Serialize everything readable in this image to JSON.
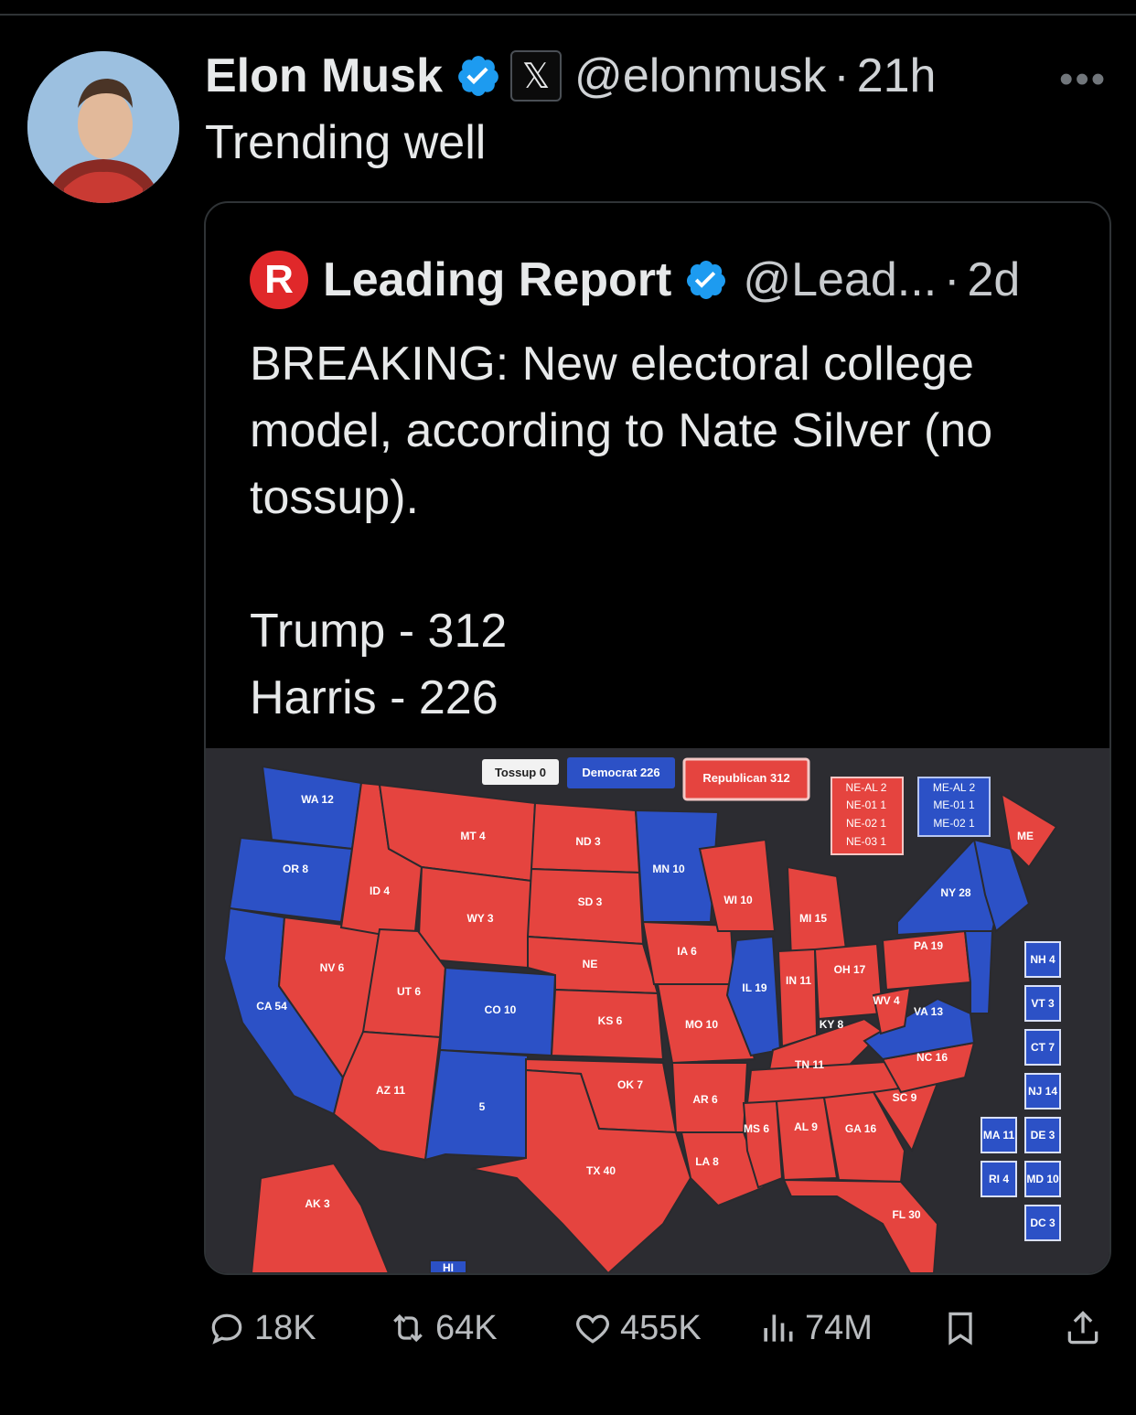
{
  "tweet": {
    "author_name": "Elon Musk",
    "handle": "@elonmusk",
    "separator": "·",
    "time": "21h",
    "text": "Trending well",
    "more_icon": "more-icon",
    "x_badge": "𝕏"
  },
  "quote": {
    "author_name": "Leading Report",
    "logo_letter": "R",
    "handle": "@Lead...",
    "separator": "·",
    "time": "2d",
    "text_lines": [
      "BREAKING: New electoral college model, according to Nate Silver (no tossup).",
      "Trump - 312",
      "Harris - 226"
    ]
  },
  "map": {
    "legend": {
      "tossup": "Tossup 0",
      "democrat": "Democrat 226",
      "republican": "Republican 312"
    },
    "ne_box": [
      "NE-AL 2",
      "NE-01 1",
      "NE-02 1",
      "NE-03 1"
    ],
    "me_box": [
      "ME-AL 2",
      "ME-01 1",
      "ME-02 1"
    ],
    "colors": {
      "democrat": "#2c51c6",
      "republican": "#e5443f",
      "background": "#2c2c31"
    },
    "states": {
      "WA": "WA 12",
      "OR": "OR 8",
      "CA": "CA 54",
      "NV": "NV 6",
      "ID": "ID 4",
      "MT": "MT 4",
      "WY": "WY 3",
      "UT": "UT 6",
      "CO": "CO 10",
      "AZ": "AZ 11",
      "NM": "5",
      "ND": "ND 3",
      "SD": "SD 3",
      "NE": "NE",
      "KS": "KS 6",
      "OK": "OK 7",
      "TX": "TX 40",
      "MN": "MN 10",
      "IA": "IA 6",
      "MO": "MO 10",
      "AR": "AR 6",
      "LA": "LA 8",
      "WI": "WI 10",
      "IL": "IL 19",
      "MI": "MI 15",
      "IN": "IN 11",
      "OH": "OH 17",
      "KY": "KY 8",
      "TN": "TN 11",
      "MS": "MS 6",
      "AL": "AL 9",
      "GA": "GA 16",
      "FL": "FL 30",
      "SC": "SC 9",
      "NC": "NC 16",
      "VA": "VA 13",
      "WV": "WV 4",
      "PA": "PA 19",
      "NY": "NY 28",
      "ME": "ME",
      "AK": "AK 3",
      "HI": "HI"
    },
    "side_boxes": {
      "NH": "NH 4",
      "VT": "VT 3",
      "CT": "CT 7",
      "NJ": "NJ 14",
      "DE": "DE 3",
      "MD": "MD 10",
      "DC": "DC 3",
      "MA": "MA 11",
      "RI": "RI 4"
    }
  },
  "actions": {
    "replies": "18K",
    "reposts": "64K",
    "likes": "455K",
    "views": "74M"
  }
}
